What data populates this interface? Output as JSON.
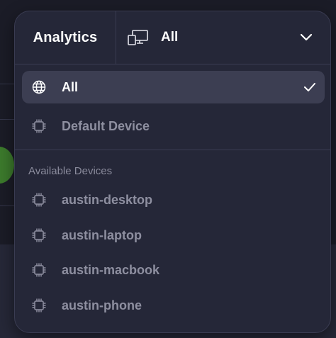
{
  "header": {
    "title": "Analytics",
    "selected_value": "All",
    "selector_icon": "devices-icon",
    "chevron_icon": "chevron-down-icon"
  },
  "options": [
    {
      "label": "All",
      "icon": "globe-icon",
      "selected": true
    },
    {
      "label": "Default Device",
      "icon": "chip-icon",
      "selected": false
    }
  ],
  "available_devices": {
    "section_label": "Available Devices",
    "items": [
      {
        "label": "austin-desktop",
        "icon": "chip-icon"
      },
      {
        "label": "austin-laptop",
        "icon": "chip-icon"
      },
      {
        "label": "austin-macbook",
        "icon": "chip-icon"
      },
      {
        "label": "austin-phone",
        "icon": "chip-icon"
      }
    ]
  },
  "colors": {
    "background": "#1b1c27",
    "dropdown": "#252738",
    "selected_row": "#3c3e52",
    "text_primary": "#ffffff",
    "text_muted": "#8e8fa0"
  }
}
